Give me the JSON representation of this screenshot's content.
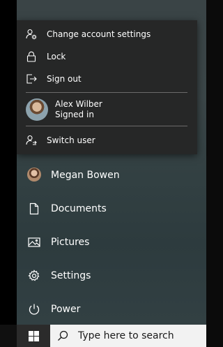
{
  "account_menu": {
    "items": [
      {
        "label": "Change account settings",
        "icon": "person-gear-icon"
      },
      {
        "label": "Lock",
        "icon": "lock-icon"
      },
      {
        "label": "Sign out",
        "icon": "sign-out-icon"
      }
    ],
    "current_user": {
      "name": "Alex Wilber",
      "status": "Signed in",
      "icon": "avatar"
    },
    "switch_user": {
      "label": "Switch user",
      "icon": "switch-user-icon"
    }
  },
  "start_menu": {
    "items": [
      {
        "label": "Megan Bowen",
        "icon": "avatar"
      },
      {
        "label": "Documents",
        "icon": "document-icon"
      },
      {
        "label": "Pictures",
        "icon": "picture-icon"
      },
      {
        "label": "Settings",
        "icon": "gear-icon"
      },
      {
        "label": "Power",
        "icon": "power-icon"
      }
    ]
  },
  "taskbar": {
    "start_icon": "windows-logo-icon",
    "search": {
      "placeholder": "Type here to search",
      "icon": "search-icon"
    }
  },
  "colors": {
    "flyout_bg": "#262727",
    "menu_bg": "#3a4446",
    "taskbar_bg": "#101010",
    "search_bg": "#f2f2f2"
  }
}
